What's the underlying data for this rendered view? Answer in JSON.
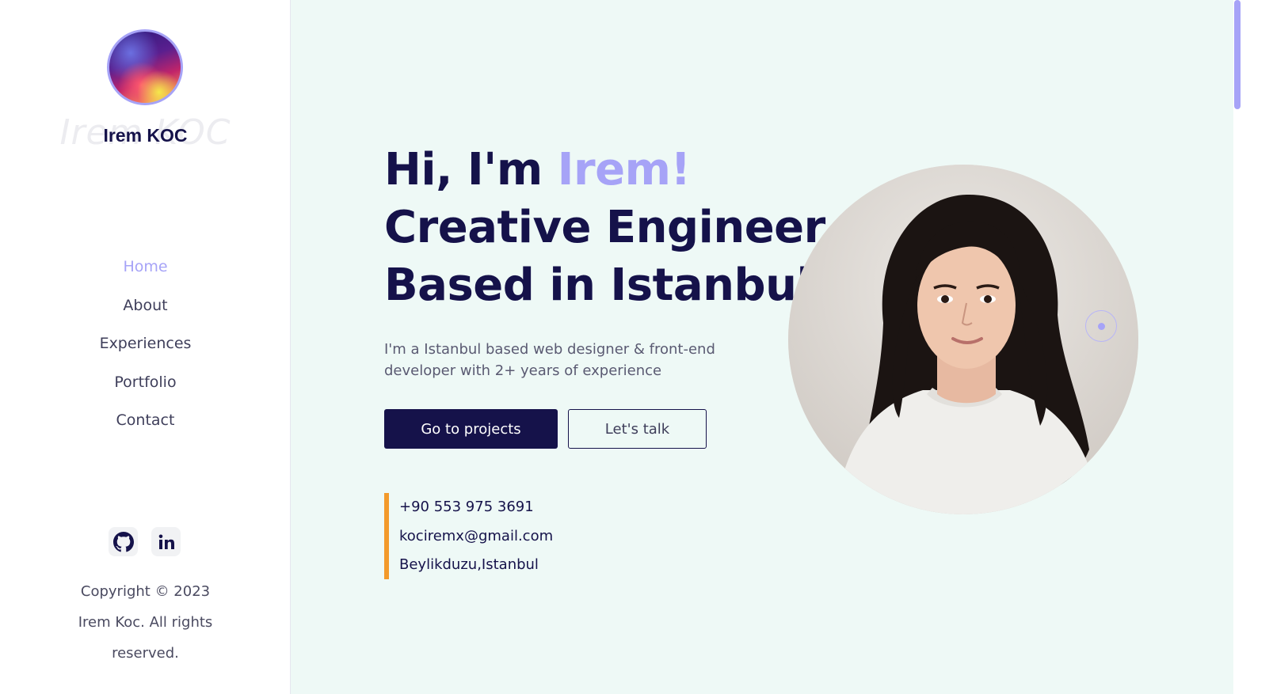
{
  "sidebar": {
    "name": "Irem KOC",
    "name_ghost": "Irem KOC",
    "nav": [
      {
        "label": "Home",
        "active": true
      },
      {
        "label": "About",
        "active": false
      },
      {
        "label": "Experiences",
        "active": false
      },
      {
        "label": "Portfolio",
        "active": false
      },
      {
        "label": "Contact",
        "active": false
      }
    ],
    "socials": [
      {
        "icon": "github-icon"
      },
      {
        "icon": "linkedin-icon"
      }
    ],
    "copyright": "Copyright © 2023 Irem Koc. All rights reserved."
  },
  "hero": {
    "greeting": "Hi, I'm ",
    "name_accent": "Irem!",
    "line2": "Creative Engineer",
    "line3": "Based in Istanbul",
    "description": "I'm a Istanbul based web designer & front-end developer with 2+ years of experience",
    "primary_button": "Go to projects",
    "secondary_button": "Let's talk",
    "contact": {
      "phone": "+90 553 975 3691",
      "email": "kociremx@gmail.com",
      "location": "Beylikduzu,Istanbul"
    }
  },
  "colors": {
    "primary": "#15124a",
    "accent": "#a6a3f7",
    "highlight_border": "#f39a2b",
    "main_bg": "#eef9f6"
  }
}
